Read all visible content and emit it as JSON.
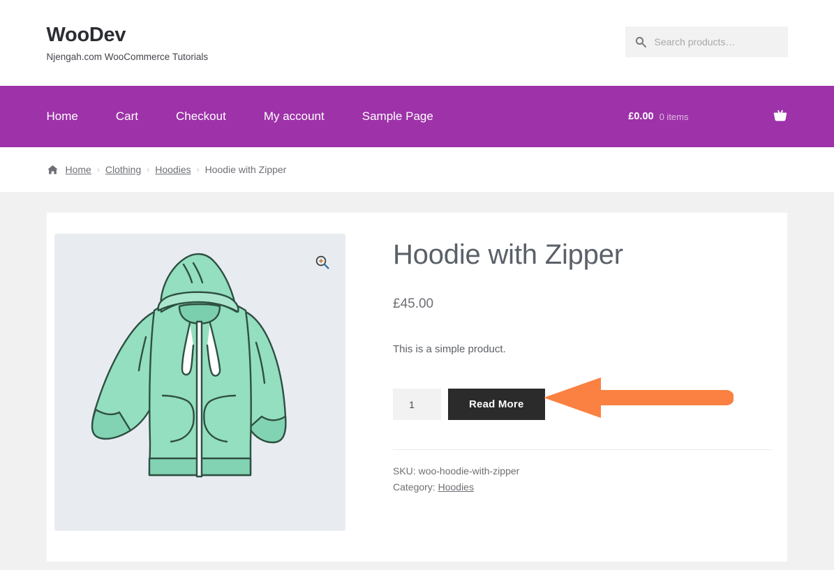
{
  "header": {
    "site_title": "WooDev",
    "site_description": "Njengah.com WooCommerce Tutorials",
    "search": {
      "placeholder": "Search products…",
      "value": "",
      "icon": "search-icon"
    }
  },
  "nav": {
    "accent_color": "#9d32a9",
    "items": [
      {
        "label": "Home"
      },
      {
        "label": "Cart"
      },
      {
        "label": "Checkout"
      },
      {
        "label": "My account"
      },
      {
        "label": "Sample Page"
      }
    ],
    "cart": {
      "total": "£0.00",
      "items_count": "0 items",
      "icon": "shopping-basket-icon"
    }
  },
  "breadcrumb": {
    "home_icon": "home-icon",
    "separator": "›",
    "items": [
      {
        "label": "Home",
        "link": true
      },
      {
        "label": "Clothing",
        "link": true
      },
      {
        "label": "Hoodies",
        "link": true
      },
      {
        "label": "Hoodie with Zipper",
        "link": false
      }
    ]
  },
  "product": {
    "title": "Hoodie with Zipper",
    "price": "£45.00",
    "description": "This is a simple product.",
    "quantity": "1",
    "add_to_cart_label": "Read More",
    "sku_label": "SKU:",
    "sku_value": "woo-hoodie-with-zipper",
    "category_label": "Category:",
    "category_value": "Hoodies",
    "gallery": {
      "zoom_icon": "magnifier-plus-icon",
      "image_alt": "Mint green zip-up hoodie illustration",
      "image_bg_color": "#e8ecf1",
      "garment_color": "#93dfc0",
      "outline_color": "#2f4f42"
    }
  },
  "annotation": {
    "type": "arrow",
    "direction": "left",
    "color": "#fa8141",
    "points_to": "Read More"
  },
  "theme": {
    "page_background": "#f1f1f1",
    "card_background": "#ffffff",
    "button_color": "#2b2b2b",
    "text_color": "#43454b"
  }
}
